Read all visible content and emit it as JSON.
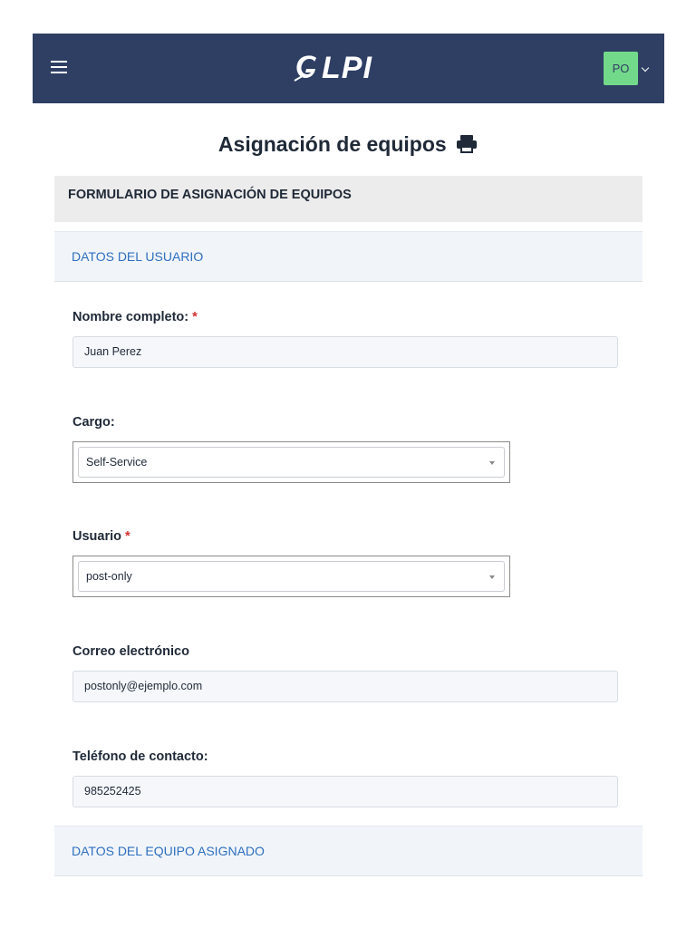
{
  "app": {
    "logo_text": "LPI",
    "user_initials": "PO"
  },
  "page": {
    "title": "Asignación de equipos"
  },
  "form": {
    "header": "FORMULARIO DE ASIGNACIÓN DE EQUIPOS",
    "sections": {
      "user_data": "DATOS DEL USUARIO",
      "equipment_data": "DATOS DEL EQUIPO ASIGNADO"
    },
    "fields": {
      "full_name": {
        "label": "Nombre completo:",
        "required_mark": "*",
        "value": "Juan Perez"
      },
      "position": {
        "label": "Cargo:",
        "selected": "Self-Service"
      },
      "user": {
        "label": "Usuario",
        "required_mark": "*",
        "selected": "post-only"
      },
      "email": {
        "label": "Correo electrónico",
        "value": "postonly@ejemplo.com"
      },
      "phone": {
        "label": "Teléfono de contacto:",
        "value": "985252425"
      }
    }
  },
  "colors": {
    "navbar": "#2f3f64",
    "avatar": "#73d98a",
    "section_link": "#2f6fbf",
    "required": "#d32f2f"
  },
  "icons": [
    "menu-icon",
    "glpi-logo",
    "chevron-down-icon",
    "print-icon",
    "dropdown-arrow-icon"
  ]
}
